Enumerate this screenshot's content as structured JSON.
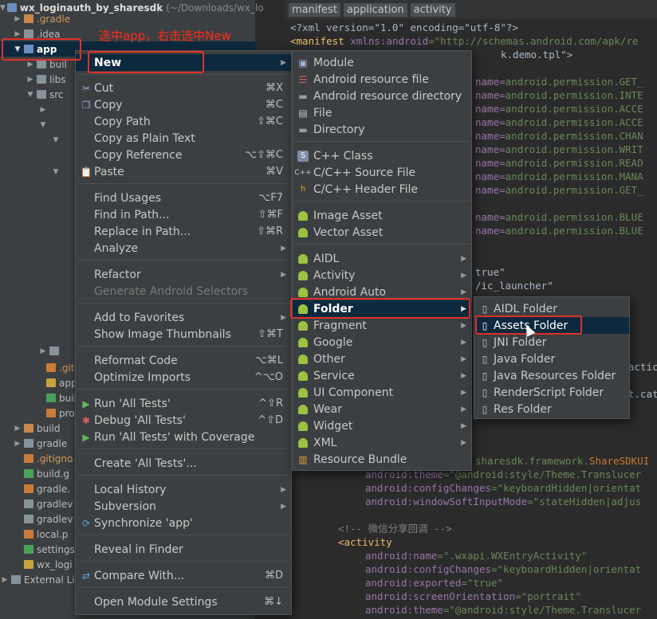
{
  "project": {
    "root_name": "wx_loginauth_by_sharesdk",
    "root_path": "(~/Downloads/wx_lo",
    "items": [
      {
        "label": ".gradle"
      },
      {
        "label": ".idea"
      },
      {
        "label": "app"
      },
      {
        "label": "buil"
      },
      {
        "label": "libs"
      },
      {
        "label": "src"
      },
      {
        "label": ".giti"
      },
      {
        "label": "app"
      },
      {
        "label": "buil"
      },
      {
        "label": "pro"
      },
      {
        "label": "build"
      },
      {
        "label": "gradle"
      },
      {
        "label": ".gitigno"
      },
      {
        "label": "build.g"
      },
      {
        "label": "gradle."
      },
      {
        "label": "gradlev"
      },
      {
        "label": "gradlev"
      },
      {
        "label": "local.p"
      },
      {
        "label": "settings"
      },
      {
        "label": "wx_logi"
      },
      {
        "label": "External Li"
      }
    ]
  },
  "annotation": "选中app，右击选中New",
  "breadcrumb": [
    "manifest",
    "application",
    "activity"
  ],
  "code": {
    "l1": "<?xml version=\"1.0\" encoding=\"utf-8\"?>",
    "l2_tag": "<manifest",
    "l2_attr": " xmlns:android",
    "l2_val": "=\"http://schemas.android.com/apk/re",
    "l3": "k.demo.tpl\">",
    "perms": [
      "android.permission.GET_",
      "android.permission.INTE",
      "android.permission.ACCE",
      "android.permission.ACCE",
      "android.permission.CHAN",
      "android.permission.WRIT",
      "android.permission.READ",
      "android.permission.MANA",
      "android.permission.GET_"
    ],
    "perms2": [
      "android.permission.BLUE",
      "android.permission.BLUE"
    ],
    "name_prefix": "name=",
    "true_val": "true\"",
    "launcher": "/ic_launcher\"",
    "sharesdk": "sharesdk.framework.",
    "sharesdk_cls": "ShareSDKUI",
    "action_frag": "actic",
    "cat_frag": "t.cat",
    "lines_bottom": [
      {
        "attr": "android:theme",
        "val": "=\"@android:style/Theme.Translucer"
      },
      {
        "attr": "android:configChanges",
        "val": "=\"keyboardHidden|orientat"
      },
      {
        "attr": "android:windowSoftInputMode",
        "val": "=\"stateHidden|adjus"
      }
    ],
    "comment": "<!-- 微信分享回调 -->",
    "activity_tag": "<activity",
    "activity_lines": [
      {
        "attr": "android:name",
        "val": "=\".wxapi.WXEntryActivity\""
      },
      {
        "attr": "android:configChanges",
        "val": "=\"keyboardHidden|orientat"
      },
      {
        "attr": "android:exported",
        "val": "=\"true\""
      },
      {
        "attr": "android:screenOrientation",
        "val": "=\"portrait\""
      },
      {
        "attr": "android:theme",
        "val": "=\"@android:style/Theme.Translucer"
      }
    ]
  },
  "context_menu": {
    "new": "New",
    "cut": "Cut",
    "cut_key": "⌘X",
    "copy": "Copy",
    "copy_key": "⌘C",
    "copy_path": "Copy Path",
    "copy_path_key": "⇧⌘C",
    "copy_plain": "Copy as Plain Text",
    "copy_ref": "Copy Reference",
    "copy_ref_key": "⌥⇧⌘C",
    "paste": "Paste",
    "paste_key": "⌘V",
    "find_usages": "Find Usages",
    "find_usages_key": "⌥F7",
    "find_in_path": "Find in Path...",
    "find_in_path_key": "⇧⌘F",
    "replace_in_path": "Replace in Path...",
    "replace_in_path_key": "⇧⌘R",
    "analyze": "Analyze",
    "refactor": "Refactor",
    "gen_selectors": "Generate Android Selectors",
    "add_favorites": "Add to Favorites",
    "show_thumbs": "Show Image Thumbnails",
    "show_thumbs_key": "⇧⌘T",
    "reformat": "Reformat Code",
    "reformat_key": "⌥⌘L",
    "optimize": "Optimize Imports",
    "optimize_key": "^⌥O",
    "run_tests": "Run 'All Tests'",
    "run_tests_key": "^⇧R",
    "debug_tests": "Debug 'All Tests'",
    "debug_tests_key": "^⇧D",
    "run_coverage": "Run 'All Tests' with Coverage",
    "create_tests": "Create 'All Tests'...",
    "local_history": "Local History",
    "subversion": "Subversion",
    "sync": "Synchronize 'app'",
    "reveal": "Reveal in Finder",
    "compare": "Compare With...",
    "compare_key": "⌘D",
    "module_settings": "Open Module Settings",
    "module_settings_key": "⌘↓"
  },
  "new_menu": {
    "module": "Module",
    "res_file": "Android resource file",
    "res_dir": "Android resource directory",
    "file": "File",
    "directory": "Directory",
    "cpp_class": "C++ Class",
    "cpp_source": "C/C++ Source File",
    "cpp_header": "C/C++ Header File",
    "image_asset": "Image Asset",
    "vector_asset": "Vector Asset",
    "aidl": "AIDL",
    "activity": "Activity",
    "android_auto": "Android Auto",
    "folder": "Folder",
    "fragment": "Fragment",
    "google": "Google",
    "other": "Other",
    "service": "Service",
    "ui_component": "UI Component",
    "wear": "Wear",
    "widget": "Widget",
    "xml": "XML",
    "resource_bundle": "Resource Bundle"
  },
  "folder_menu": {
    "aidl_folder": "AIDL Folder",
    "assets_folder": "Assets Folder",
    "jni_folder": "JNI Folder",
    "java_folder": "Java Folder",
    "java_res_folder": "Java Resources Folder",
    "renderscript_folder": "RenderScript Folder",
    "res_folder": "Res Folder"
  },
  "colors": {
    "selection": "#0d293e",
    "annotation_red": "#e0302a",
    "android_green": "#9bc241"
  }
}
